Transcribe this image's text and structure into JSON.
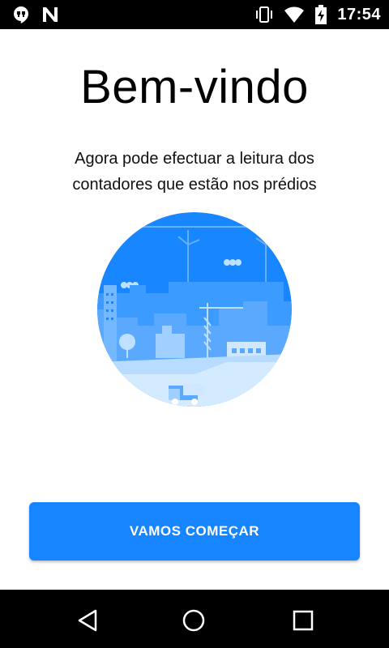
{
  "status_bar": {
    "time": "17:54",
    "icons_left": [
      "hangouts-icon",
      "n-notification-icon"
    ],
    "icons_right": [
      "vibrate-icon",
      "wifi-icon",
      "battery-charging-icon"
    ]
  },
  "welcome": {
    "title": "Bem-vindo",
    "subtitle": "Agora pode efectuar a leitura dos contadores que estão nos prédios"
  },
  "primary_action": {
    "label": "VAMOS COMEÇAR",
    "color": "#1685ff"
  },
  "nav_bar": {
    "buttons": [
      "back-icon",
      "home-icon",
      "recents-icon"
    ]
  },
  "colors": {
    "accent": "#1685ff",
    "illustration_light": "#9fd0ff",
    "illustration_mid": "#5aa9ff"
  }
}
